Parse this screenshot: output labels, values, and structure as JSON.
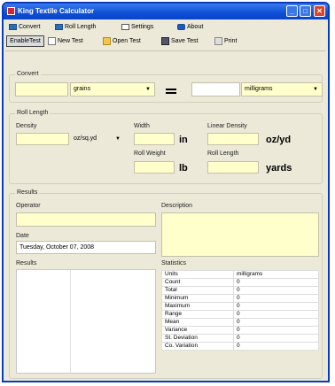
{
  "window": {
    "title": "King Textile Calculator",
    "minimize": "_",
    "maximize": "□",
    "close": "✕"
  },
  "menu": {
    "convert": "Convert",
    "roll_length": "Roll Length",
    "settings": "Settings",
    "about": "About"
  },
  "toolbar": {
    "enable_test": "EnableTest",
    "new_test": "New Test",
    "open_test": "Open Test",
    "save_test": "Save Test",
    "print": "Print"
  },
  "convert": {
    "title": "Convert",
    "from_value": "",
    "from_unit": "grains",
    "to_value": "",
    "to_unit": "milligrams"
  },
  "roll": {
    "title": "Roll Length",
    "density_label": "Density",
    "density_unit": "oz/sq.yd",
    "width_label": "Width",
    "width_unit": "in",
    "linear_density_label": "Linear Density",
    "linear_density_unit": "oz/yd",
    "roll_weight_label": "Roll Weight",
    "roll_weight_unit": "lb",
    "roll_length_label": "Roll Length",
    "roll_length_unit": "yards"
  },
  "results": {
    "title": "Results",
    "operator_label": "Operator",
    "description_label": "Description",
    "date_label": "Date",
    "date_value": "Tuesday, October 07, 2008",
    "results_label": "Results",
    "statistics_label": "Statistics",
    "stats": [
      {
        "name": "Units",
        "value": "milligrams"
      },
      {
        "name": "Count",
        "value": "0"
      },
      {
        "name": "Total",
        "value": "0"
      },
      {
        "name": "Minimum",
        "value": "0"
      },
      {
        "name": "Maximum",
        "value": "0"
      },
      {
        "name": "Range",
        "value": "0"
      },
      {
        "name": "Mean",
        "value": "0"
      },
      {
        "name": "Variance",
        "value": "0"
      },
      {
        "name": "St. Deviation",
        "value": "0"
      },
      {
        "name": "Co. Variation",
        "value": "0"
      }
    ]
  },
  "colors": {
    "titlebar": "#0d4fd6",
    "field_yellow": "#ffffcc",
    "window_bg": "#ece9d8"
  }
}
